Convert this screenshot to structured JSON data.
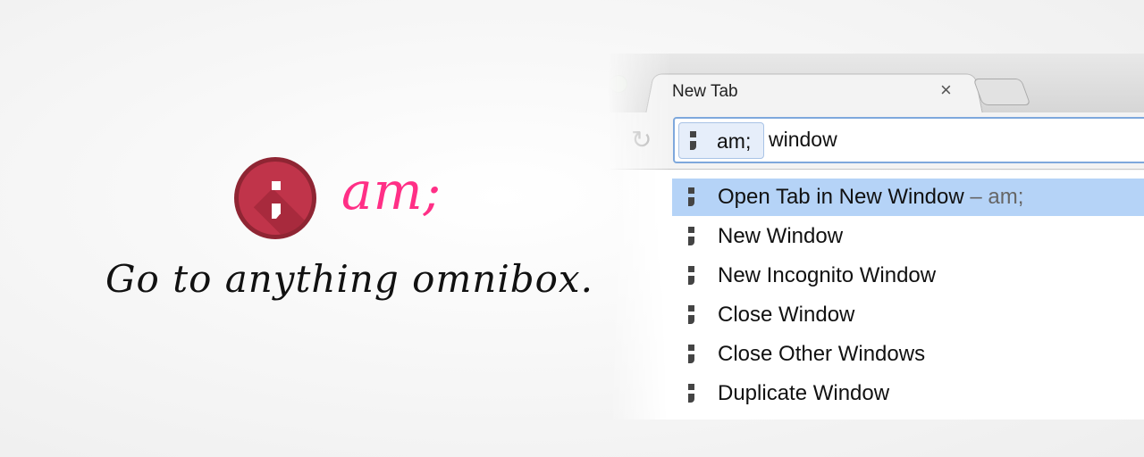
{
  "brand": {
    "name": "am;",
    "tagline": "Go to anything omnibox.",
    "logo_color": "#c0344a",
    "name_color": "#ff2f86"
  },
  "browser": {
    "tab": {
      "title": "New Tab",
      "close_icon": "×"
    },
    "omnibox": {
      "keyword_chip": "am;",
      "query": "window"
    },
    "suggestions": [
      {
        "label": "Open Tab in New Window",
        "suffix": " – am;",
        "selected": true
      },
      {
        "label": "New Window"
      },
      {
        "label": "New Incognito Window"
      },
      {
        "label": "Close Window"
      },
      {
        "label": "Close Other Windows"
      },
      {
        "label": "Duplicate Window"
      }
    ],
    "highlight_color": "#b5d3f7"
  }
}
